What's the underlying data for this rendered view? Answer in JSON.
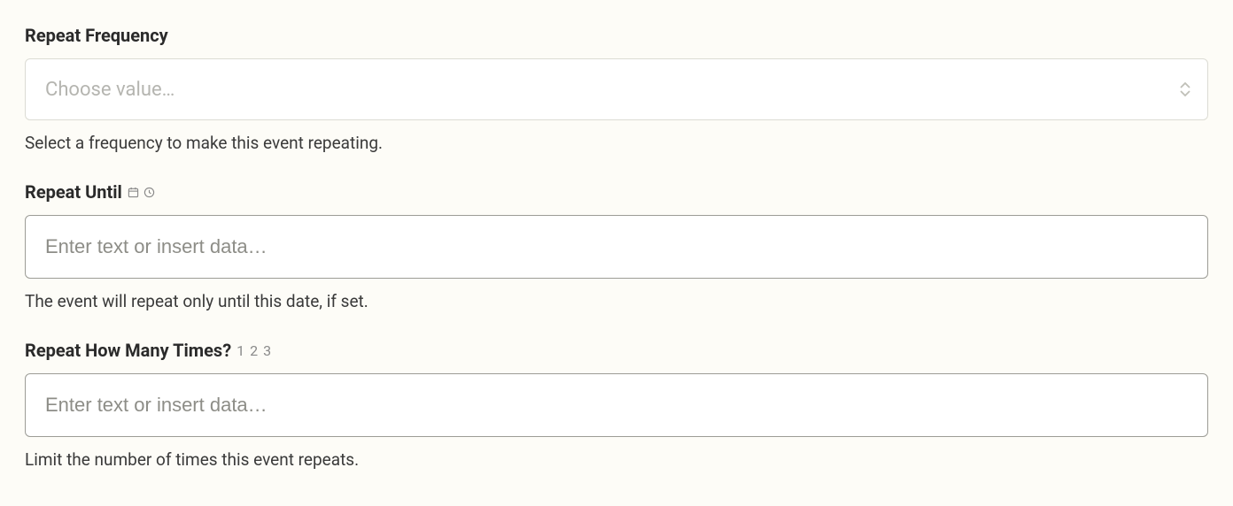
{
  "fields": {
    "repeat_frequency": {
      "label": "Repeat Frequency",
      "placeholder": "Choose value…",
      "help": "Select a frequency to make this event repeating."
    },
    "repeat_until": {
      "label": "Repeat Until",
      "placeholder": "Enter text or insert data…",
      "help": "The event will repeat only until this date, if set."
    },
    "repeat_times": {
      "label": "Repeat How Many Times?",
      "hint": "1 2 3",
      "placeholder": "Enter text or insert data…",
      "help": "Limit the number of times this event repeats."
    }
  }
}
